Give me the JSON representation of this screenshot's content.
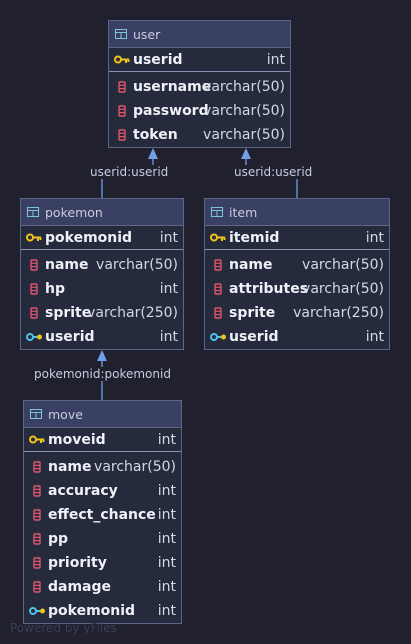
{
  "colors": {
    "background": "#20202f",
    "header": "#3a4063",
    "body": "#262a3d",
    "border": "#5e6687",
    "edge": "#6fa0e6",
    "key_icon": "#f0c419",
    "column_icon": "#e0556a",
    "fk_icon": "#4fc3e8"
  },
  "entities": {
    "user": {
      "title": "user",
      "pk": {
        "name": "userid",
        "type": "int",
        "icon": "key-icon"
      },
      "columns": [
        {
          "name": "username",
          "type": "varchar(50)",
          "icon": "column-icon"
        },
        {
          "name": "password",
          "type": "varchar(50)",
          "icon": "column-icon"
        },
        {
          "name": "token",
          "type": "varchar(50)",
          "icon": "column-icon"
        }
      ]
    },
    "pokemon": {
      "title": "pokemon",
      "pk": {
        "name": "pokemonid",
        "type": "int",
        "icon": "key-icon"
      },
      "columns": [
        {
          "name": "name",
          "type": "varchar(50)",
          "icon": "column-icon"
        },
        {
          "name": "hp",
          "type": "int",
          "icon": "column-icon"
        },
        {
          "name": "sprite",
          "type": "varchar(250)",
          "icon": "column-icon"
        },
        {
          "name": "userid",
          "type": "int",
          "icon": "foreign-key-icon"
        }
      ]
    },
    "item": {
      "title": "item",
      "pk": {
        "name": "itemid",
        "type": "int",
        "icon": "key-icon"
      },
      "columns": [
        {
          "name": "name",
          "type": "varchar(50)",
          "icon": "column-icon"
        },
        {
          "name": "attributes",
          "type": "varchar(50)",
          "icon": "column-icon"
        },
        {
          "name": "sprite",
          "type": "varchar(250)",
          "icon": "column-icon"
        },
        {
          "name": "userid",
          "type": "int",
          "icon": "foreign-key-icon"
        }
      ]
    },
    "move": {
      "title": "move",
      "pk": {
        "name": "moveid",
        "type": "int",
        "icon": "key-icon"
      },
      "columns": [
        {
          "name": "name",
          "type": "varchar(50)",
          "icon": "column-icon"
        },
        {
          "name": "accuracy",
          "type": "int",
          "icon": "column-icon"
        },
        {
          "name": "effect_chance",
          "type": "int",
          "icon": "column-icon"
        },
        {
          "name": "pp",
          "type": "int",
          "icon": "column-icon"
        },
        {
          "name": "priority",
          "type": "int",
          "icon": "column-icon"
        },
        {
          "name": "damage",
          "type": "int",
          "icon": "column-icon"
        },
        {
          "name": "pokemonid",
          "type": "int",
          "icon": "foreign-key-icon"
        }
      ]
    }
  },
  "relations": {
    "pokemon_user": "userid:userid",
    "item_user": "userid:userid",
    "move_pokemon": "pokemonid:pokemonid"
  },
  "footer": "Powered by yFiles"
}
